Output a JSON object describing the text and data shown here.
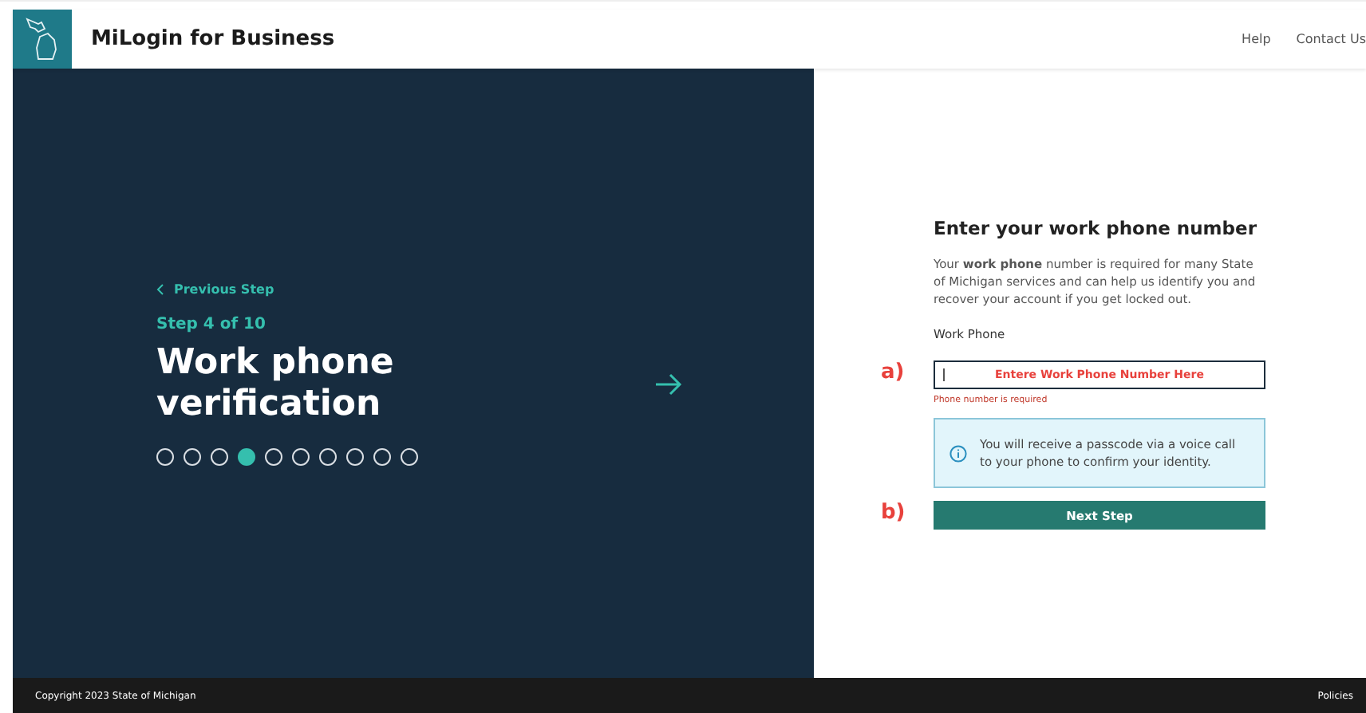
{
  "header": {
    "title": "MiLogin for Business",
    "links": [
      "Help",
      "Contact Us"
    ]
  },
  "hero": {
    "back_link": "Previous Step",
    "step": "Step 4 of 10",
    "title": "Work phone verification",
    "steps": [
      {
        "selected": false
      },
      {
        "selected": false
      },
      {
        "selected": false
      },
      {
        "selected": true
      },
      {
        "selected": false
      },
      {
        "selected": false
      },
      {
        "selected": false
      },
      {
        "selected": false
      },
      {
        "selected": false
      },
      {
        "selected": false
      }
    ]
  },
  "form": {
    "heading": "Enter your work phone number",
    "description": "Your **work phone** number is required for many State of Michigan services and can help us identify you and recover your account if you get locked out.",
    "field_label": "Work Phone",
    "field_annotation": "a)",
    "field_overlay": "Entere Work Phone Number Here",
    "error": "Phone number is required",
    "info": "You will receive a passcode via a voice call to your phone to confirm your identity.",
    "button_annotation": "b)",
    "button": "Next Step"
  },
  "footer": {
    "copyright": "Copyright 2023 State of Michigan",
    "link": "Policies"
  }
}
